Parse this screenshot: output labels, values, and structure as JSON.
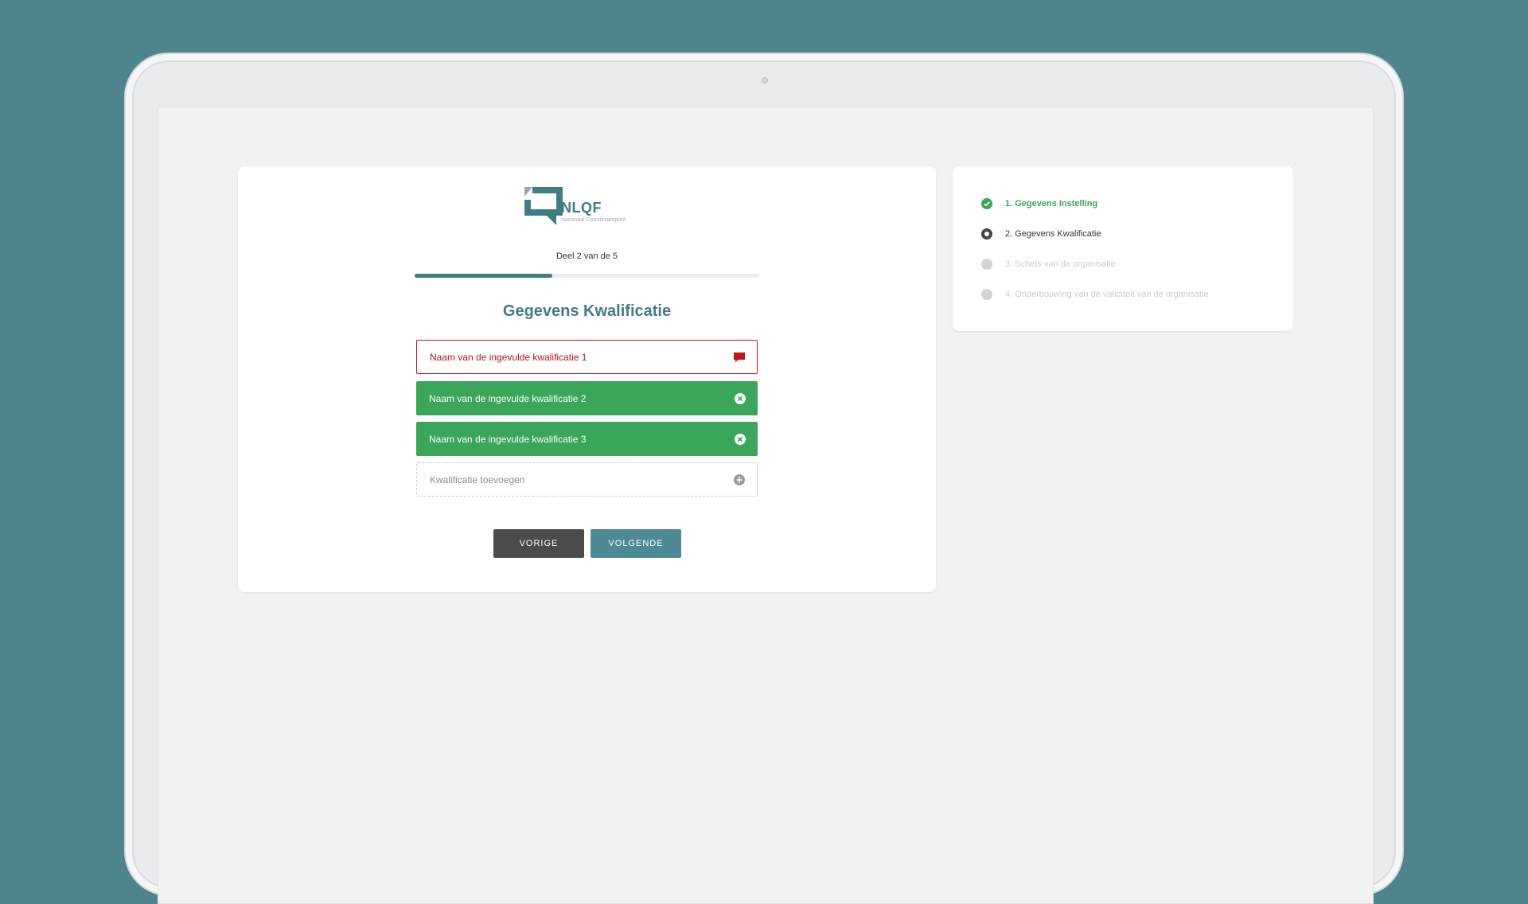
{
  "brand": {
    "name": "NLQF",
    "subtitle": "Nationaal Coördinatiepunt"
  },
  "progress": {
    "label": "Deel 2 van de 5",
    "fraction": 0.4
  },
  "form": {
    "title": "Gegevens Kwalificatie",
    "items": [
      {
        "label": "Naam van de ingevulde kwalificatie 1",
        "state": "error",
        "icon": "comment-alert-icon"
      },
      {
        "label": "Naam van de ingevulde kwalificatie 2",
        "state": "complete",
        "icon": "close-circle-icon"
      },
      {
        "label": "Naam van de ingevulde kwalificatie 3",
        "state": "complete",
        "icon": "close-circle-icon"
      }
    ],
    "add_label": "Kwalificatie toevoegen",
    "prev_label": "VORIGE",
    "next_label": "VOLGENDE"
  },
  "steps": [
    {
      "label": "1. Gegevens Instelling",
      "state": "done"
    },
    {
      "label": "2. Gegevens Kwalificatie",
      "state": "current"
    },
    {
      "label": "3. Schets van de organisatie",
      "state": "todo"
    },
    {
      "label": "4. Onderbouwing van de validiteit van de organisatie",
      "state": "todo"
    }
  ],
  "colors": {
    "background": "#4e858d",
    "accent": "#3f7d86",
    "success": "#3aa65a",
    "error": "#c4121a",
    "button_dark": "#4b4b4b"
  }
}
